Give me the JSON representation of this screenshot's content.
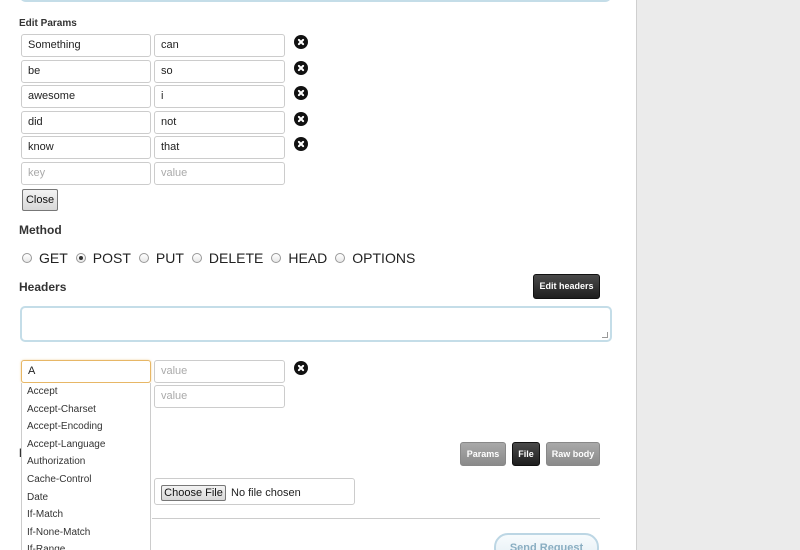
{
  "edit_params": {
    "title": "Edit Params",
    "rows": [
      {
        "key": "Something",
        "value": "can"
      },
      {
        "key": "be",
        "value": "so"
      },
      {
        "key": "awesome",
        "value": "i"
      },
      {
        "key": "did",
        "value": "not"
      },
      {
        "key": "know",
        "value": "that"
      }
    ],
    "new_key_placeholder": "key",
    "new_value_placeholder": "value",
    "close_label": "Close"
  },
  "method": {
    "title": "Method",
    "options": [
      "GET",
      "POST",
      "PUT",
      "DELETE",
      "HEAD",
      "OPTIONS"
    ],
    "selected": "POST"
  },
  "headers": {
    "title": "Headers",
    "edit_label": "Edit headers",
    "row1_key": "A",
    "row1_value_placeholder": "value",
    "row2_value_placeholder": "value",
    "autocomplete": [
      "Accept",
      "Accept-Charset",
      "Accept-Encoding",
      "Accept-Language",
      "Authorization",
      "Cache-Control",
      "Date",
      "If-Match",
      "If-None-Match",
      "If-Range"
    ]
  },
  "body": {
    "hidden_section_letter": "I",
    "tabs": [
      "Params",
      "File",
      "Raw body"
    ],
    "active_tab": "File",
    "choose_file_label": "Choose File",
    "no_file_text": "No file chosen"
  },
  "send_label": "Send Request",
  "colors": {
    "dark_button": "#2a2a2a",
    "gray_button": "#999999",
    "focus_border": "#e7b766",
    "textarea_border": "#c4dde8"
  }
}
